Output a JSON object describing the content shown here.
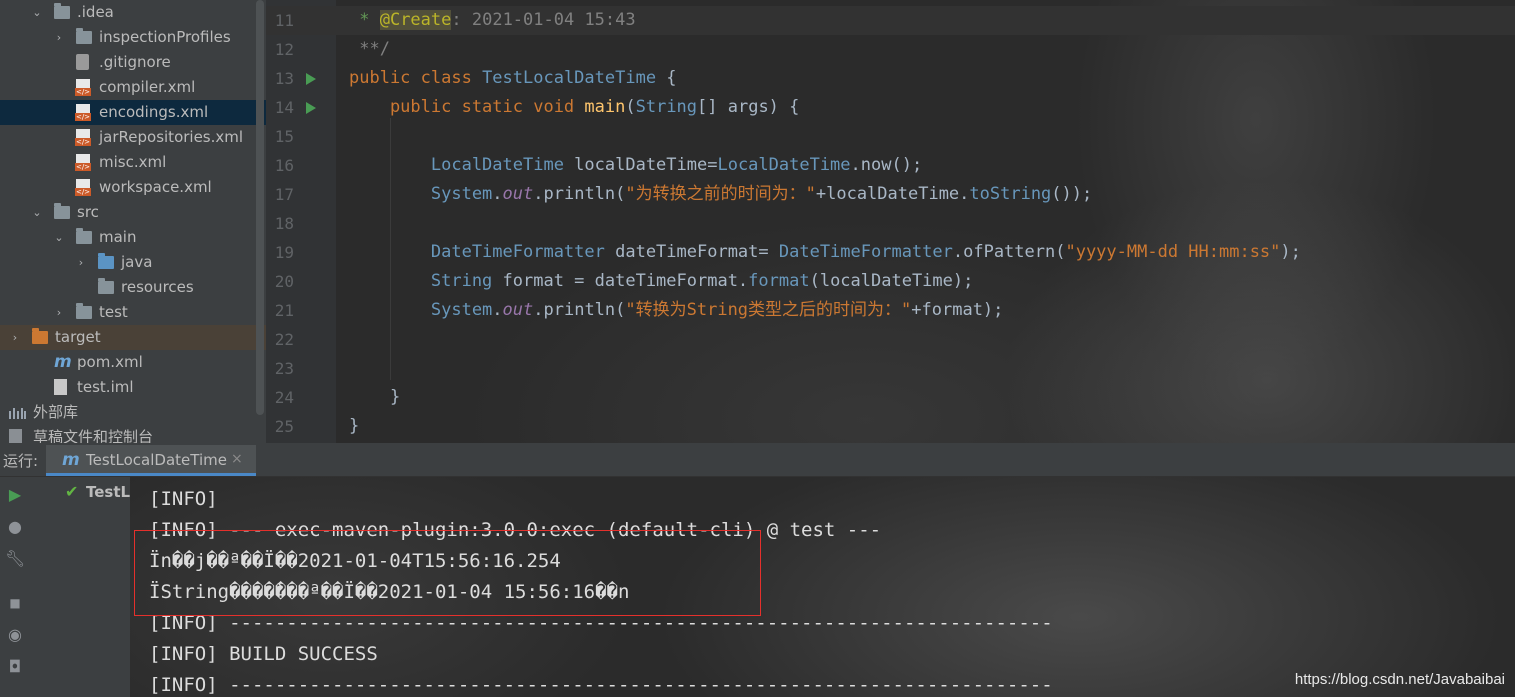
{
  "project_tree": [
    {
      "label": ".idea",
      "indent": 1,
      "arrow": "⌄",
      "icon": "folder",
      "icon_color": "#87939a"
    },
    {
      "label": "inspectionProfiles",
      "indent": 2,
      "arrow": "›",
      "icon": "folder",
      "icon_color": "#87939a"
    },
    {
      "label": ".gitignore",
      "indent": 2,
      "arrow": "",
      "icon": "gitignore-file-icon"
    },
    {
      "label": "compiler.xml",
      "indent": 2,
      "arrow": "",
      "icon": "xml-file-icon"
    },
    {
      "label": "encodings.xml",
      "indent": 2,
      "arrow": "",
      "icon": "xml-file-icon",
      "selected": true
    },
    {
      "label": "jarRepositories.xml",
      "indent": 2,
      "arrow": "",
      "icon": "xml-file-icon"
    },
    {
      "label": "misc.xml",
      "indent": 2,
      "arrow": "",
      "icon": "xml-file-icon"
    },
    {
      "label": "workspace.xml",
      "indent": 2,
      "arrow": "",
      "icon": "xml-file-icon"
    },
    {
      "label": "src",
      "indent": 1,
      "arrow": "⌄",
      "icon": "folder",
      "icon_color": "#87939a"
    },
    {
      "label": "main",
      "indent": 2,
      "arrow": "⌄",
      "icon": "folder",
      "icon_color": "#87939a"
    },
    {
      "label": "java",
      "indent": 3,
      "arrow": "›",
      "icon": "folder",
      "icon_color": "#5b94c4"
    },
    {
      "label": "resources",
      "indent": 3,
      "arrow": "",
      "icon": "folder",
      "icon_color": "#87939a"
    },
    {
      "label": "test",
      "indent": 2,
      "arrow": "›",
      "icon": "folder",
      "icon_color": "#87939a"
    },
    {
      "label": "target",
      "indent": 0,
      "arrow": "›",
      "icon": "folder",
      "icon_color": "#cc7832",
      "highlighted": true
    },
    {
      "label": "pom.xml",
      "indent": 1,
      "arrow": "",
      "icon": "maven-icon"
    },
    {
      "label": "test.iml",
      "indent": 1,
      "arrow": "",
      "icon": "iml-file-icon"
    },
    {
      "label": "外部库",
      "indent": 0,
      "arrow": "",
      "icon": "library-icon"
    },
    {
      "label": "草稿文件和控制台",
      "indent": 0,
      "arrow": "",
      "icon": "scratch-icon"
    }
  ],
  "editor": {
    "lines": [
      {
        "num": "11",
        "current": true,
        "run": false,
        "tokens": [
          [
            "cmt",
            " * "
          ],
          [
            "annot",
            "@Create"
          ],
          [
            "cmtg",
            ": "
          ],
          [
            "cmtg",
            "2021-01-04 15:43"
          ]
        ]
      },
      {
        "num": "12",
        "tokens": [
          [
            "cmtg",
            " **/"
          ]
        ]
      },
      {
        "num": "13",
        "run": true,
        "tokens": [
          [
            "kw",
            "public class "
          ],
          [
            "cls",
            "TestLocalDateTime"
          ],
          [
            "plain",
            " {"
          ]
        ]
      },
      {
        "num": "14",
        "run": true,
        "tokens": [
          [
            "kw",
            "    public static void "
          ],
          [
            "fn",
            "main"
          ],
          [
            "plain",
            "("
          ],
          [
            "cls",
            "String"
          ],
          [
            "plain",
            "[] args) {"
          ]
        ]
      },
      {
        "num": "15",
        "tokens": []
      },
      {
        "num": "16",
        "tokens": [
          [
            "cls",
            "        LocalDateTime"
          ],
          [
            "plain",
            " localDateTime="
          ],
          [
            "cls",
            "LocalDateTime"
          ],
          [
            "plain",
            ".now();"
          ]
        ]
      },
      {
        "num": "17",
        "tokens": [
          [
            "cls",
            "        System"
          ],
          [
            "plain",
            "."
          ],
          [
            "fld",
            "out"
          ],
          [
            "plain",
            ".println("
          ],
          [
            "strc",
            "\"为转换之前的时间为：\""
          ],
          [
            "plain",
            "+localDateTime."
          ],
          [
            "cls",
            "toString"
          ],
          [
            "plain",
            "());"
          ]
        ]
      },
      {
        "num": "18",
        "tokens": []
      },
      {
        "num": "19",
        "tokens": [
          [
            "cls",
            "        DateTimeFormatter"
          ],
          [
            "plain",
            " dateTimeFormat= "
          ],
          [
            "cls",
            "DateTimeFormatter"
          ],
          [
            "plain",
            ".ofPattern("
          ],
          [
            "strc",
            "\"yyyy-MM-dd HH:mm:ss\""
          ],
          [
            "plain",
            ");"
          ]
        ]
      },
      {
        "num": "20",
        "tokens": [
          [
            "cls",
            "        String"
          ],
          [
            "plain",
            " format = dateTimeFormat."
          ],
          [
            "cls",
            "format"
          ],
          [
            "plain",
            "(localDateTime);"
          ]
        ]
      },
      {
        "num": "21",
        "tokens": [
          [
            "cls",
            "        System"
          ],
          [
            "plain",
            "."
          ],
          [
            "fld",
            "out"
          ],
          [
            "plain",
            ".println("
          ],
          [
            "strc",
            "\"转换为String类型之后的时间为：\""
          ],
          [
            "plain",
            "+format);"
          ]
        ]
      },
      {
        "num": "22",
        "tokens": []
      },
      {
        "num": "23",
        "tokens": []
      },
      {
        "num": "24",
        "tokens": [
          [
            "plain",
            "    }"
          ]
        ]
      },
      {
        "num": "25",
        "tokens": [
          [
            "plain",
            "}"
          ]
        ]
      }
    ]
  },
  "run_panel": {
    "label": "运行:",
    "tab_label": "TestLocalDateTime",
    "tab_close": "×",
    "tree_label": "TestLocalDateTime",
    "console_lines": [
      "[INFO]",
      "[INFO] --- exec-maven-plugin:3.0.0:exec (default-cli) @ test ---",
      "Ïn��j��ª��Ï��2021-01-04T15:56:16.254",
      "ÏString����̀���ª��Ï��2021-01-04 15:56:16��n",
      "[INFO] ------------------------------------------------------------------------",
      "[INFO] BUILD SUCCESS",
      "[INFO] ------------------------------------------------------------------------"
    ]
  },
  "watermark": "https://blog.csdn.net/Javabaibai",
  "colors": {
    "keyword": "#cc7832",
    "class": "#6897bb",
    "plain": "#a9b7c6",
    "field": "#9876aa",
    "string": "#cc7832",
    "highlight_box": "#e5302c",
    "run_green": "#499c54"
  }
}
